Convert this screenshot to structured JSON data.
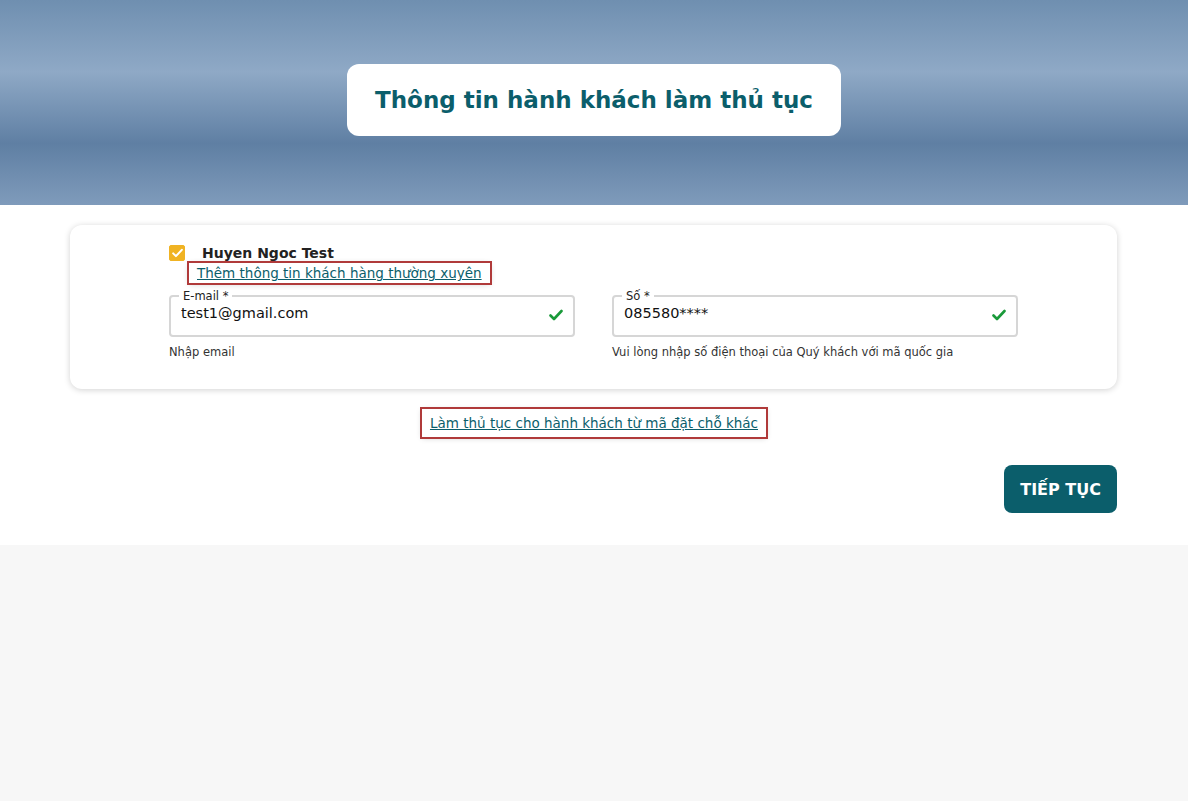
{
  "header": {
    "title": "Thông tin hành khách làm thủ tục"
  },
  "passenger": {
    "name": "Huyen Ngoc Test",
    "checked": true,
    "frequent_flyer_link": {
      "text": "Thêm thông tin khách hàng thường xuyên",
      "highlighted": true
    }
  },
  "fields": [
    {
      "label": "E-mail *",
      "value": "test1@gmail.com",
      "helper": "Nhập email",
      "valid": true
    },
    {
      "label": "Số *",
      "value": "085580****",
      "helper": "Vui lòng nhập số điện thoại của Quý khách với mã quốc gia",
      "valid": true
    }
  ],
  "other_booking_link": {
    "text": "Làm thủ tục cho hành khách từ mã đặt chỗ khác",
    "highlighted": true
  },
  "buttons": [
    "TIẾP TỤC"
  ]
}
